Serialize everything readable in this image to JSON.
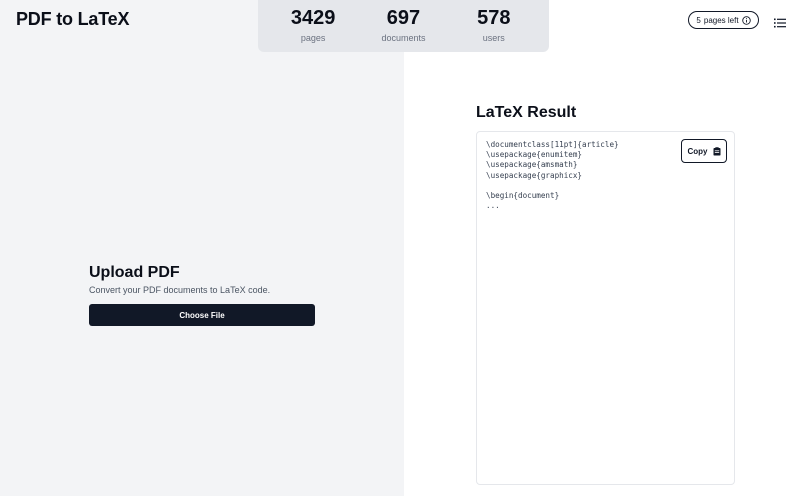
{
  "app": {
    "title": "PDF to LaTeX"
  },
  "stats": [
    {
      "value": "3429",
      "label": "pages"
    },
    {
      "value": "697",
      "label": "documents"
    },
    {
      "value": "578",
      "label": "users"
    }
  ],
  "header": {
    "pages_left_count": "5",
    "pages_left_label": "pages left",
    "info_icon": "info-icon",
    "menu_icon": "list-icon"
  },
  "upload": {
    "title": "Upload PDF",
    "subtitle": "Convert your PDF documents to LaTeX code.",
    "button_label": "Choose File"
  },
  "result": {
    "title": "LaTeX Result",
    "code": "\\documentclass[11pt]{article}\n\\usepackage{enumitem}\n\\usepackage{amsmath}\n\\usepackage{graphicx}\n\n\\begin{document}\n...",
    "copy_label": "Copy",
    "copy_icon": "clipboard-icon"
  },
  "colors": {
    "left_bg": "#f3f4f6",
    "stats_bg": "#e5e7eb",
    "button_bg": "#111827",
    "text_muted": "#6b7280"
  }
}
